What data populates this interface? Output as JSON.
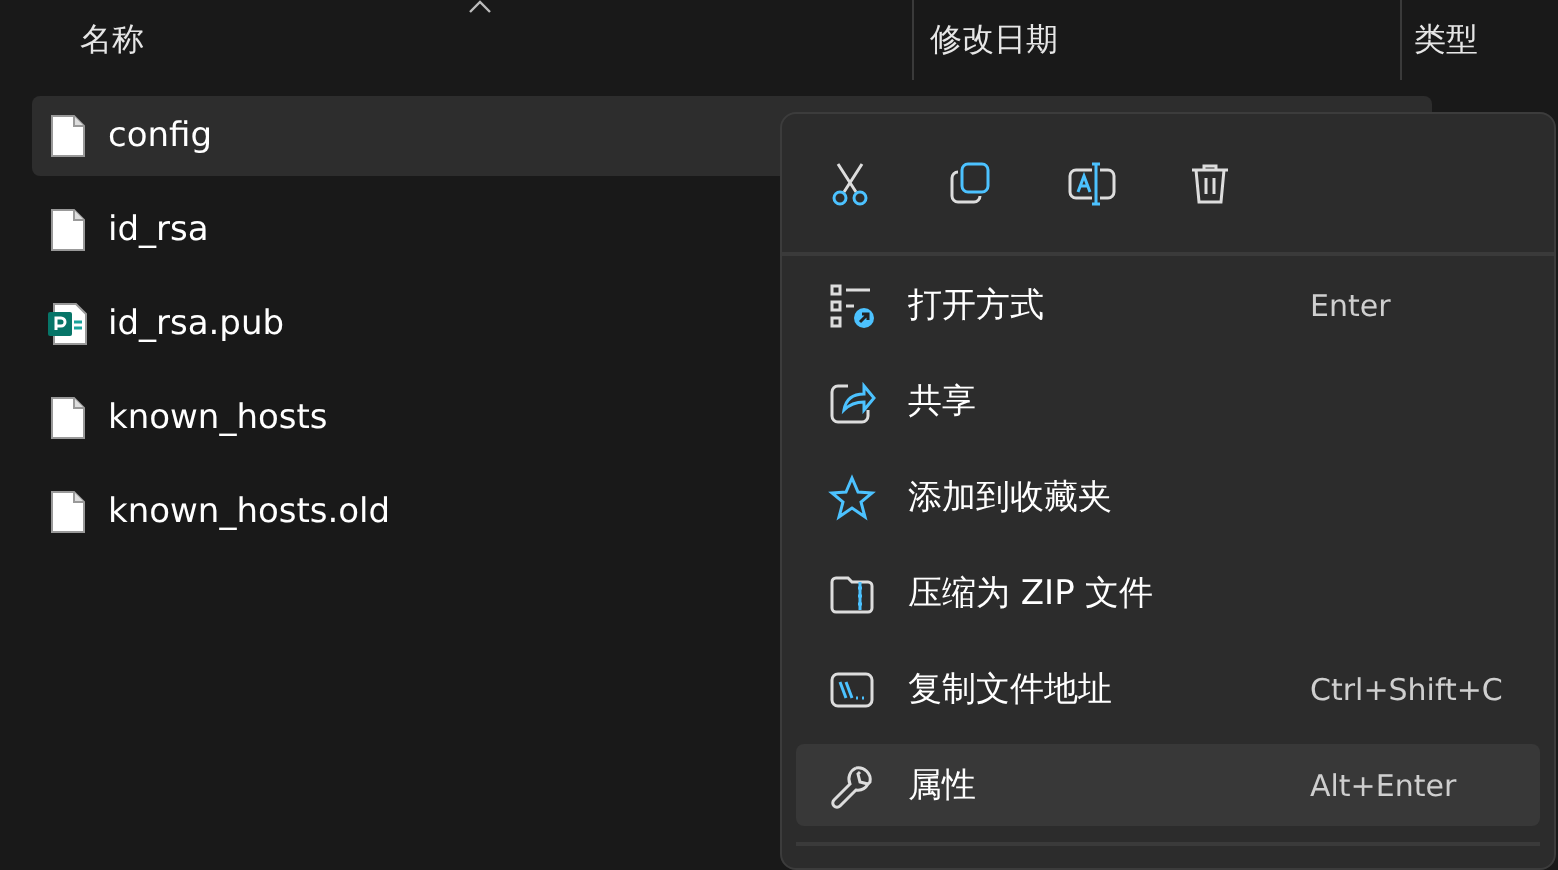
{
  "columns": [
    {
      "label": "名称"
    },
    {
      "label": "修改日期"
    },
    {
      "label": "类型"
    }
  ],
  "files": [
    {
      "name": "config",
      "kind": "plain",
      "selected": true
    },
    {
      "name": "id_rsa",
      "kind": "plain",
      "selected": false
    },
    {
      "name": "id_rsa.pub",
      "kind": "badge",
      "selected": false
    },
    {
      "name": "known_hosts",
      "kind": "plain",
      "selected": false
    },
    {
      "name": "known_hosts.old",
      "kind": "plain",
      "selected": false
    }
  ],
  "context_menu": {
    "items": [
      {
        "label": "打开方式",
        "shortcut": "Enter",
        "selected": false
      },
      {
        "label": "共享",
        "selected": false
      },
      {
        "label": "添加到收藏夹",
        "selected": false
      },
      {
        "label": "压缩为 ZIP 文件",
        "selected": false
      },
      {
        "label": "复制文件地址",
        "shortcut": "Ctrl+Shift+C",
        "selected": false
      },
      {
        "label": "属性",
        "shortcut": "Alt+Enter",
        "selected": true
      }
    ]
  }
}
